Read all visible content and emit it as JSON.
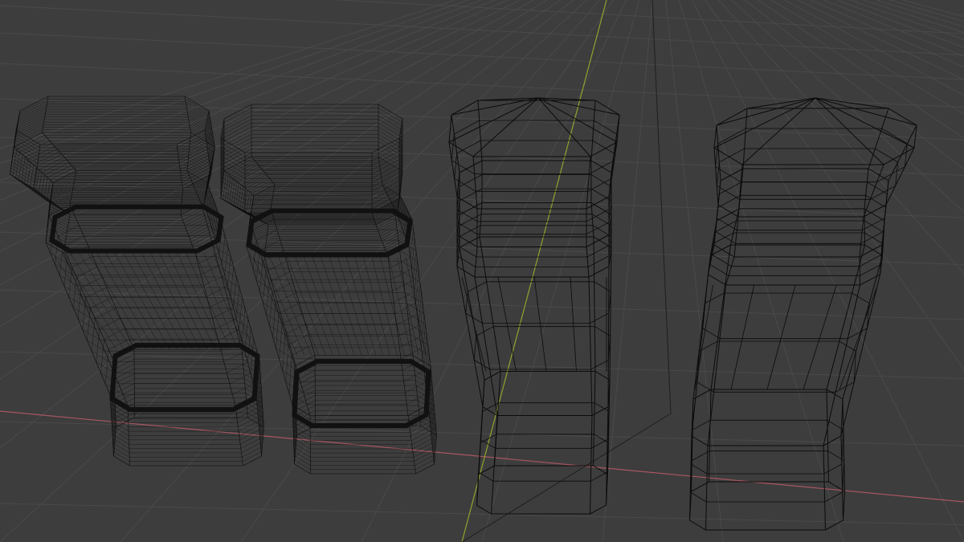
{
  "viewport": {
    "view_mode": "wireframe",
    "background_color": "#3d3d3d",
    "grid_color": "#4a4a4a",
    "x_axis_color": "#a85661",
    "y_axis_color": "#8fa32e",
    "wire_color": "#0b0b0b",
    "wire_color_light": "#111111"
  },
  "objects": [
    {
      "id": "jar-dense-1",
      "subdivision": "high",
      "description_name": "wireframe-jar-dense-1"
    },
    {
      "id": "jar-dense-2",
      "subdivision": "high",
      "description_name": "wireframe-jar-dense-2"
    },
    {
      "id": "jar-low-1",
      "subdivision": "low",
      "description_name": "wireframe-jar-low-1"
    },
    {
      "id": "jar-low-2",
      "subdivision": "low",
      "description_name": "wireframe-jar-low-2"
    }
  ]
}
